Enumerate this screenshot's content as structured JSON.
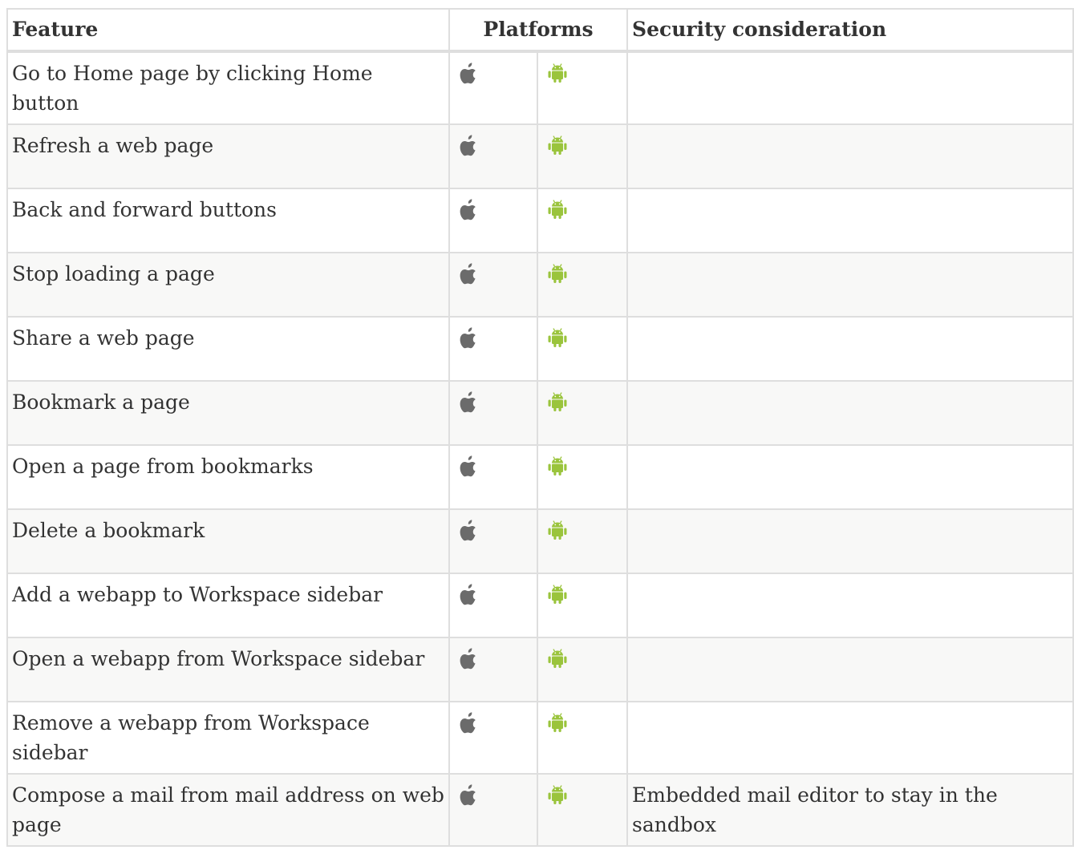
{
  "table": {
    "headers": {
      "feature": "Feature",
      "platforms": "Platforms",
      "security": "Security consideration"
    },
    "icons": {
      "ios": "apple-icon",
      "android": "android-icon",
      "ios_color": "#6b6b6b",
      "android_color": "#9ac43c"
    },
    "rows": [
      {
        "feature": "Go to Home page by clicking Home button",
        "security": ""
      },
      {
        "feature": "Refresh a web page",
        "security": ""
      },
      {
        "feature": "Back and forward buttons",
        "security": ""
      },
      {
        "feature": "Stop loading a page",
        "security": ""
      },
      {
        "feature": "Share a web page",
        "security": ""
      },
      {
        "feature": "Bookmark a page",
        "security": ""
      },
      {
        "feature": "Open a page from bookmarks",
        "security": ""
      },
      {
        "feature": "Delete a bookmark",
        "security": ""
      },
      {
        "feature": "Add a webapp to Workspace sidebar",
        "security": ""
      },
      {
        "feature": "Open a webapp from Workspace sidebar",
        "security": ""
      },
      {
        "feature": "Remove a webapp from Workspace sidebar",
        "security": ""
      },
      {
        "feature": "Compose a mail from mail address on web page",
        "security": "Embedded mail editor to stay in the sandbox"
      }
    ]
  }
}
